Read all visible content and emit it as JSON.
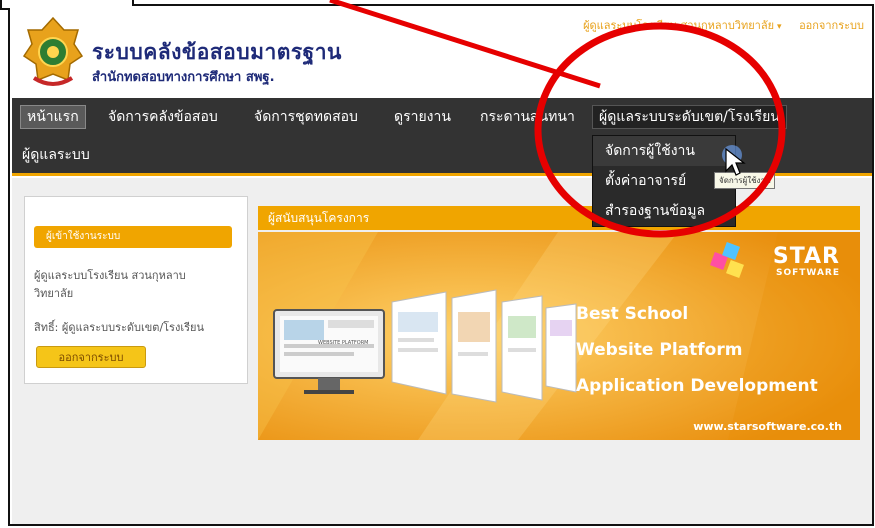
{
  "header": {
    "title": "ระบบคลังข้อสอบมาตรฐาน",
    "subtitle": "สำนักทดสอบทางการศึกษา สพฐ.",
    "user_link": "ผู้ดูแลระบบโรงเรียน สวนกุหลาบวิทยาลัย",
    "logout_link": "ออกจากระบบ"
  },
  "nav": {
    "items": [
      {
        "label": "หน้าแรก"
      },
      {
        "label": "จัดการคลังข้อสอบ"
      },
      {
        "label": "จัดการชุดทดสอบ"
      },
      {
        "label": "ดูรายงาน"
      },
      {
        "label": "กระดานสนทนา"
      },
      {
        "label": "ผู้ดูแลระบบระดับเขต/โรงเรียน"
      },
      {
        "label": "ผู้ดูแลระบบ"
      }
    ]
  },
  "dropdown": {
    "items": [
      {
        "label": "จัดการผู้ใช้งาน"
      },
      {
        "label": "ตั้งค่าอาจารย์"
      },
      {
        "label": "สำรองฐานข้อมูล"
      }
    ],
    "tooltip": "จัดการผู้ใช้งาน"
  },
  "sidebar": {
    "heading": "ผู้เข้าใช้งานระบบ",
    "user_line1": "ผู้ดูแลระบบโรงเรียน สวนกุหลาบ",
    "user_line2": "วิทยาลัย",
    "rights": "สิทธิ์: ผู้ดูแลระบบระดับเขต/โรงเรียน",
    "logout_button": "ออกจากระบบ"
  },
  "main": {
    "heading": "ผู้สนับสนุนโครงการ",
    "banner": {
      "brand": "STAR",
      "brand_sub": "SOFTWARE",
      "line1": "Best School",
      "line2": "Website Platform",
      "line3": "Application Development",
      "url": "www.starsoftware.co.th",
      "screen_label": "WEBSITE PLATFORM"
    }
  },
  "colors": {
    "accent": "#f0a500",
    "nav_bg": "#333333",
    "title": "#1e2a78",
    "annotation": "#e60000"
  }
}
